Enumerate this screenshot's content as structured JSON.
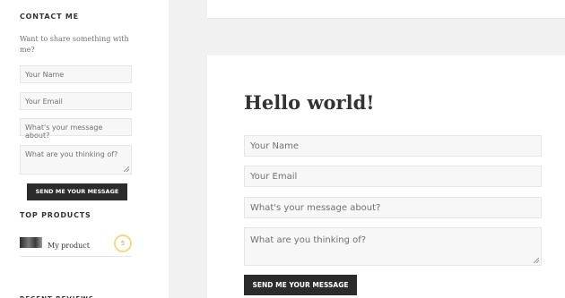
{
  "sidebar": {
    "contact_title": "CONTACT ME",
    "intro": "Want to share something with me?",
    "form": {
      "name_placeholder": "Your Name",
      "email_placeholder": "Your Email",
      "subject_placeholder": "What's your message about?",
      "message_placeholder": "What are you thinking of?",
      "submit_label": "SEND ME YOUR MESSAGE"
    },
    "products_title": "TOP PRODUCTS",
    "product": {
      "name": "My product",
      "count": "5"
    },
    "next_widget_title": "RECENT REVIEWS"
  },
  "main": {
    "post_title": "Hello world!",
    "form": {
      "name_placeholder": "Your Name",
      "email_placeholder": "Your Email",
      "subject_placeholder": "What's your message about?",
      "message_placeholder": "What are you thinking of?",
      "submit_label": "SEND ME YOUR MESSAGE"
    }
  },
  "colors": {
    "page_bg": "#f1f1f1",
    "card_bg": "#ffffff",
    "button_bg": "#2b2b2b",
    "field_bg": "#f7f7f7",
    "badge_accent": "#f3d98a"
  }
}
